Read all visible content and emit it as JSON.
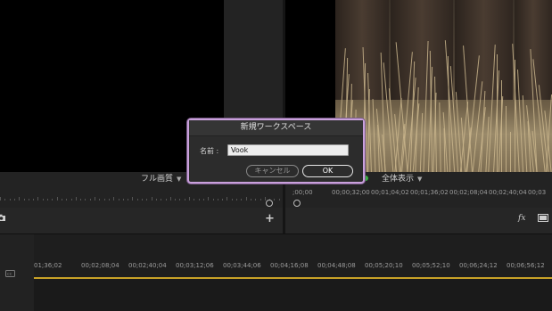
{
  "source_monitor": {
    "quality_dropdown": "フル画質"
  },
  "program_monitor": {
    "zoom_dropdown": "全体表示",
    "ruler_labels": [
      ";00;00",
      "00;00;32;00",
      "00;01;04;02",
      "00;01;36;02",
      "00;02;08;04",
      "00;02;40;04",
      "00;03"
    ]
  },
  "timeline": {
    "ruler_labels": [
      "01;36;02",
      "00;02;08;04",
      "00;02;40;04",
      "00;03;12;06",
      "00;03;44;06",
      "00;04;16;08",
      "00;04;48;08",
      "00;05;20;10",
      "00;05;52;10",
      "00;06;24;12",
      "00;06;56;12",
      "00;07"
    ]
  },
  "dialog": {
    "title": "新規ワークスペース",
    "name_label": "名前 :",
    "name_value": "Vook",
    "cancel_label": "キャンセル",
    "ok_label": "OK"
  },
  "icons": {
    "camera": "camera-icon",
    "add": "add-icon",
    "fx": "fx",
    "display": "display-icon",
    "captions": "captions-icon"
  },
  "colors": {
    "dialog_border": "#c9a0dc",
    "workarea_bar": "#c9a227",
    "status_green": "#3cb043"
  }
}
